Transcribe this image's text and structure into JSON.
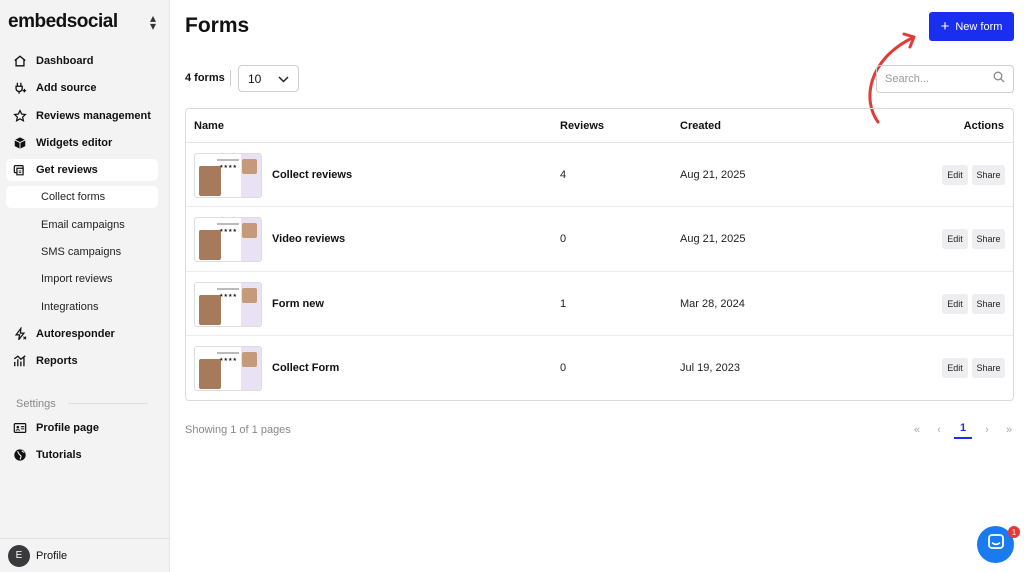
{
  "brand": {
    "logo_text": "embedsocial",
    "accent_color": "#1a2ef0",
    "arrow_color": "#e53935"
  },
  "sidebar": {
    "items": [
      {
        "label": "Dashboard",
        "icon": "home-icon"
      },
      {
        "label": "Add source",
        "icon": "plug-icon"
      },
      {
        "label": "Reviews management",
        "icon": "star-icon"
      },
      {
        "label": "Widgets editor",
        "icon": "cube-icon"
      },
      {
        "label": "Get reviews",
        "icon": "inbox-icon"
      }
    ],
    "subitems": [
      {
        "label": "Collect forms"
      },
      {
        "label": "Email campaigns"
      },
      {
        "label": "SMS campaigns"
      },
      {
        "label": "Import reviews"
      },
      {
        "label": "Integrations"
      }
    ],
    "items_after": [
      {
        "label": "Autoresponder",
        "icon": "bolt-icon"
      },
      {
        "label": "Reports",
        "icon": "chart-icon"
      }
    ],
    "settings_label": "Settings",
    "settings_items": [
      {
        "label": "Profile page",
        "icon": "id-card-icon"
      },
      {
        "label": "Tutorials",
        "icon": "globe-icon"
      }
    ],
    "profile": {
      "initial": "E",
      "label": "Profile"
    }
  },
  "main": {
    "title": "Forms",
    "new_button_label": "New form",
    "count_label": "4 forms",
    "per_page_value": "10",
    "search_placeholder": "Search...",
    "table": {
      "headers": {
        "name": "Name",
        "reviews": "Reviews",
        "created": "Created",
        "actions": "Actions"
      },
      "rows": [
        {
          "name": "Collect reviews",
          "reviews": "4",
          "created": "Aug 21, 2025"
        },
        {
          "name": "Video reviews",
          "reviews": "0",
          "created": "Aug 21, 2025"
        },
        {
          "name": "Form new",
          "reviews": "1",
          "created": "Mar 28, 2024"
        },
        {
          "name": "Collect Form",
          "reviews": "0",
          "created": "Jul 19, 2023"
        }
      ],
      "edit_label": "Edit",
      "share_label": "Share"
    },
    "showing_text": "Showing 1 of 1 pages",
    "pagination": {
      "current_page": "1"
    }
  },
  "chat": {
    "badge_count": "1"
  }
}
